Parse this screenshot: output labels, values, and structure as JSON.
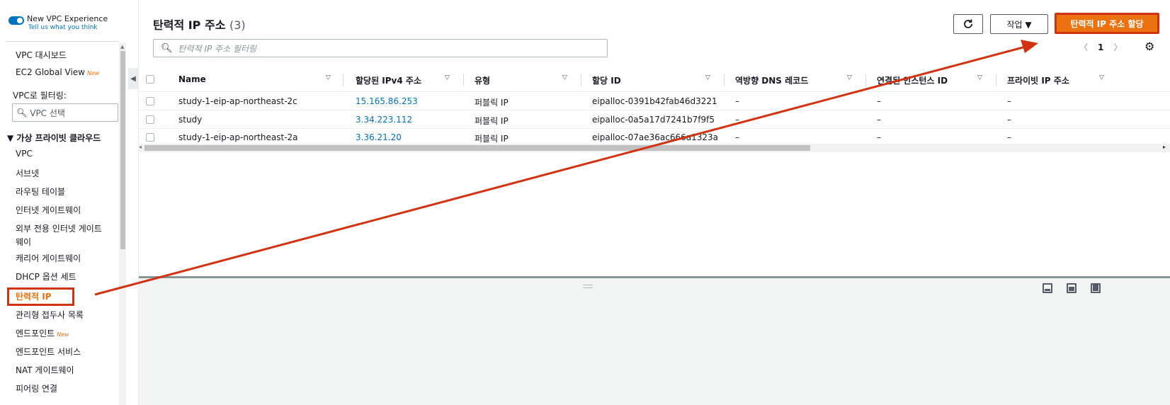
{
  "colors": {
    "accent": "#ec7211",
    "link": "#0073bb",
    "annotation": "#d13212"
  },
  "vpc_experience": {
    "title": "New VPC Experience",
    "subtitle": "Tell us what you think"
  },
  "sidebar": {
    "top_items": [
      {
        "label": "VPC 대시보드"
      },
      {
        "label": "EC2 Global View",
        "badge": "New"
      }
    ],
    "filter_label": "VPC로 필터링:",
    "filter_placeholder": "VPC 선택",
    "section_title": "▼ 가상 프라이빗 클라우드",
    "items": [
      {
        "label": "VPC"
      },
      {
        "label": "서브넷"
      },
      {
        "label": "라우팅 테이블"
      },
      {
        "label": "인터넷 게이트웨이"
      },
      {
        "label": "외부 전용 인터넷 게이트",
        "label2": "웨이"
      },
      {
        "label": "캐리어 게이트웨이"
      },
      {
        "label": "DHCP 옵션 세트"
      },
      {
        "label": "탄력적 IP",
        "active": true
      },
      {
        "label": "관리형 접두사 목록"
      },
      {
        "label": "엔드포인트",
        "badge": "New"
      },
      {
        "label": "엔드포인트 서비스"
      },
      {
        "label": "NAT 게이트웨이"
      },
      {
        "label": "피어링 연결"
      }
    ]
  },
  "header": {
    "title": "탄력적 IP 주소",
    "count": "(3)",
    "action_label": "작업 ▼",
    "allocate_label": "탄력적 IP 주소 할당"
  },
  "search": {
    "placeholder": "탄력적 IP 주소 필터링"
  },
  "pagination": {
    "prev": "〈",
    "page": "1",
    "next": "〉"
  },
  "table": {
    "columns": [
      "Name",
      "할당된 IPv4 주소",
      "유형",
      "할당 ID",
      "역방향 DNS 레코드",
      "연결된 인스턴스 ID",
      "프라이빗 IP 주소"
    ],
    "rows": [
      [
        "study-1-eip-ap-northeast-2c",
        "15.165.86.253",
        "퍼블릭 IP",
        "eipalloc-0391b42fab46d3221",
        "–",
        "–",
        "–"
      ],
      [
        "study",
        "3.34.223.112",
        "퍼블릭 IP",
        "eipalloc-0a5a17d7241b7f9f5",
        "–",
        "–",
        "–"
      ],
      [
        "study-1-eip-ap-northeast-2a",
        "3.36.21.20",
        "퍼블릭 IP",
        "eipalloc-07ae36ac666a1323a",
        "–",
        "–",
        "–"
      ]
    ]
  }
}
